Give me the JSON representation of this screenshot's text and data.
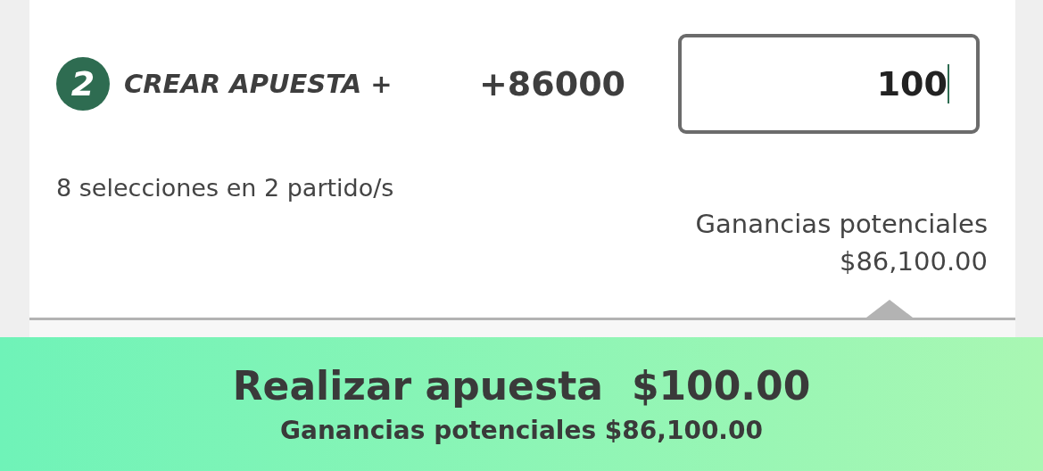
{
  "step": {
    "number": "2",
    "title": "CREAR APUESTA +",
    "odds": "+86000"
  },
  "stake_input": {
    "value": "100"
  },
  "selections_summary": "8 selecciones en 2 partido/s",
  "potential_winnings": {
    "label": "Ganancias potenciales",
    "amount": "$86,100.00"
  },
  "place_bet_button": {
    "label": "Realizar apuesta",
    "amount": "$100.00",
    "subtitle": "Ganancias potenciales $86,100.00"
  }
}
